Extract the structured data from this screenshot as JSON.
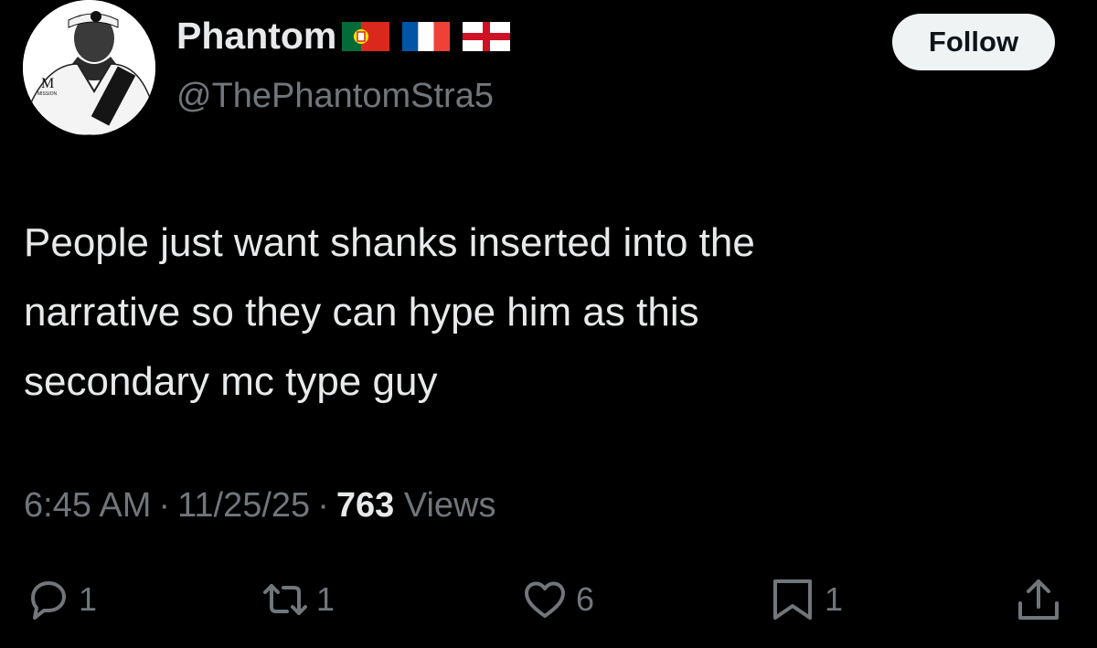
{
  "author": {
    "display_name": "Phantom",
    "flags": [
      "portugal-flag",
      "france-flag",
      "england-flag"
    ],
    "handle": "@ThePhantomStra5"
  },
  "follow_label": "Follow",
  "tweet": {
    "lines": [
      "People just want shanks inserted into the",
      "narrative so they can hype him as this",
      "secondary mc type guy"
    ]
  },
  "meta": {
    "time": "6:45 AM",
    "separator": "·",
    "date": "11/25/25",
    "views_count": "763",
    "views_label": "Views"
  },
  "actions": {
    "reply": {
      "icon": "reply-icon",
      "count": "1"
    },
    "retweet": {
      "icon": "retweet-icon",
      "count": "1"
    },
    "like": {
      "icon": "heart-icon",
      "count": "6"
    },
    "bookmark": {
      "icon": "bookmark-icon",
      "count": "1"
    },
    "share": {
      "icon": "share-icon"
    }
  },
  "colors": {
    "background": "#000000",
    "text": "#e7e9ea",
    "secondary": "#71767b",
    "button_bg": "#eff3f4",
    "button_text": "#0f1419"
  }
}
